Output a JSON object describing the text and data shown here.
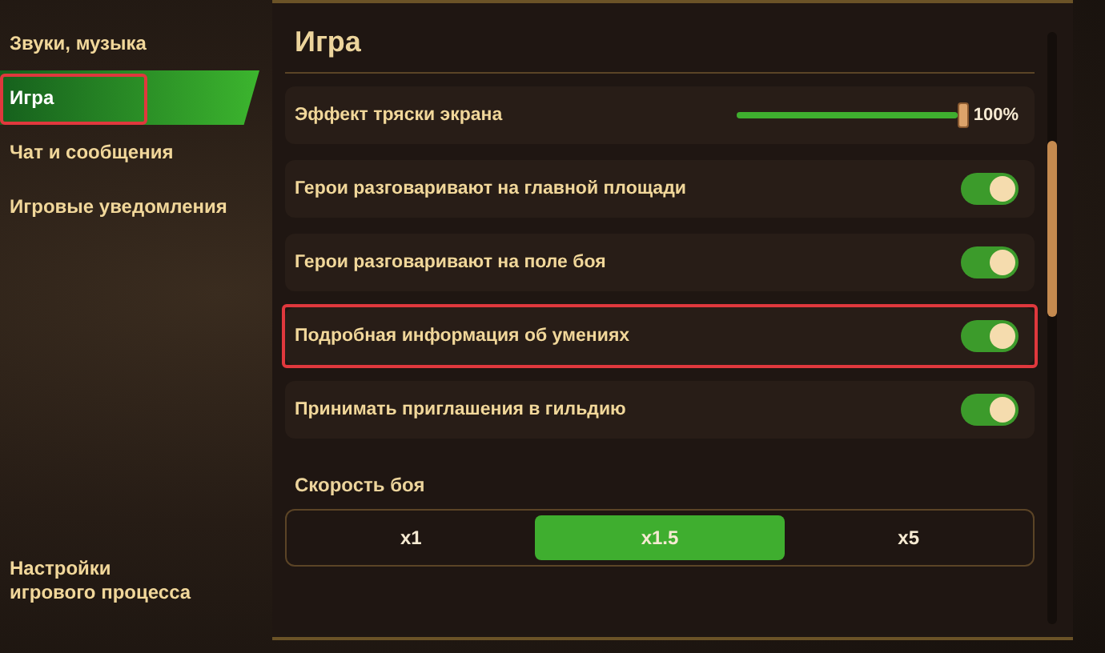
{
  "sidebar": {
    "items": [
      {
        "label": "Звуки, музыка",
        "selected": false,
        "highlighted": false
      },
      {
        "label": "Игра",
        "selected": true,
        "highlighted": true
      },
      {
        "label": "Чат и сообщения",
        "selected": false,
        "highlighted": false
      },
      {
        "label": "Игровые уведомления",
        "selected": false,
        "highlighted": false
      }
    ],
    "footer": "Настройки игрового процесса"
  },
  "panel": {
    "title": "Игра",
    "settings": [
      {
        "kind": "slider",
        "label": "Эффект тряски экрана",
        "level": 1,
        "reading": "100%",
        "highlighted": false
      },
      {
        "kind": "toggle",
        "label": "Герои разговаривают на главной площади",
        "on": true,
        "highlighted": false
      },
      {
        "kind": "toggle",
        "label": "Герои разговаривают на поле боя",
        "on": true,
        "highlighted": false
      },
      {
        "kind": "toggle",
        "label": "Подробная информация об умениях",
        "on": true,
        "highlighted": true
      },
      {
        "kind": "toggle",
        "label": "Принимать приглашения в гильдию",
        "on": true,
        "highlighted": false
      }
    ],
    "speed": {
      "label": "Скорость боя",
      "options": [
        {
          "label": "x1",
          "selected": false
        },
        {
          "label": "x1.5",
          "selected": true
        },
        {
          "label": "x5",
          "selected": false
        }
      ]
    }
  }
}
